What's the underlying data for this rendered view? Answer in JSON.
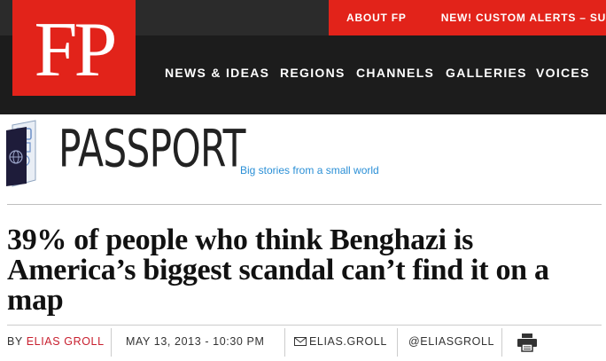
{
  "header": {
    "logo_text": "FP",
    "utility": {
      "about": "ABOUT FP",
      "alerts": "NEW! CUSTOM ALERTS – SUBSCRIBE"
    },
    "nav": [
      "NEWS & IDEAS",
      "REGIONS",
      "CHANNELS",
      "GALLERIES",
      "VOICES"
    ]
  },
  "blog": {
    "title": "PASSPORT",
    "tagline": "Big stories from a small world"
  },
  "article": {
    "headline": "39% of people who think Benghazi is America’s biggest scandal can’t find it on a map",
    "byline_prefix": "BY",
    "author": "ELIAS GROLL",
    "date": "MAY 13, 2013 - 10:30 PM",
    "email": "ELIAS.GROLL",
    "twitter": "@ELIASGROLL"
  },
  "colors": {
    "brand_red": "#e2231a",
    "header_black": "#1c1c1c",
    "link_blue": "#2a8fd6",
    "author_red": "#c8202f"
  },
  "icons": {
    "passport": "passport-book-icon",
    "mail": "mail-icon",
    "print": "printer-icon"
  }
}
